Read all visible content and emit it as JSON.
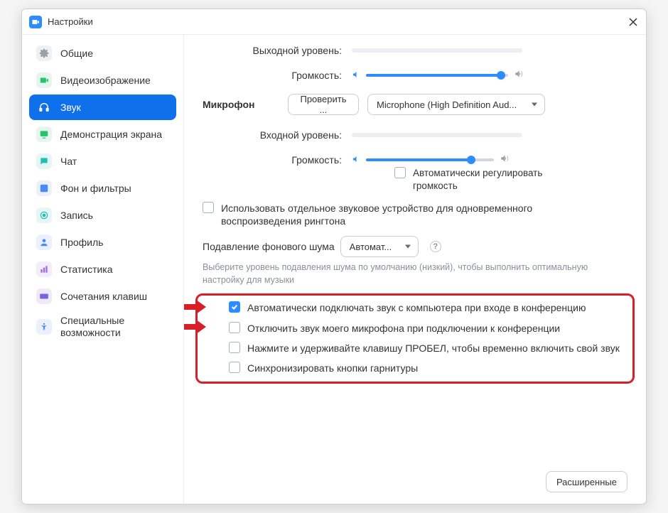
{
  "window": {
    "title": "Настройки"
  },
  "sidebar": {
    "items": [
      {
        "label": "Общие"
      },
      {
        "label": "Видеоизображение"
      },
      {
        "label": "Звук"
      },
      {
        "label": "Демонстрация экрана"
      },
      {
        "label": "Чат"
      },
      {
        "label": "Фон и фильтры"
      },
      {
        "label": "Запись"
      },
      {
        "label": "Профиль"
      },
      {
        "label": "Статистика"
      },
      {
        "label": "Сочетания клавиш"
      },
      {
        "label": "Специальные возможности"
      }
    ]
  },
  "content": {
    "output_level_label": "Выходной уровень:",
    "volume_label": "Громкость:",
    "microphone_heading": "Микрофон",
    "test_button": "Проверить ...",
    "mic_device": "Microphone (High Definition Aud...",
    "input_level_label": "Входной уровень:",
    "auto_adjust_volume": "Автоматически регулировать громкость",
    "separate_ringtone": "Использовать отдельное звуковое устройство для одновременного воспроизведения рингтона",
    "noise_suppress_label": "Подавление фонового шума",
    "noise_suppress_value": "Автомат...",
    "noise_hint": "Выберите уровень подавления шума по умолчанию (низкий), чтобы выполнить оптимальную настройку для музыки",
    "checkboxes": [
      {
        "label": "Автоматически подключать звук с компьютера при входе в конференцию",
        "checked": true
      },
      {
        "label": "Отключить звук моего микрофона при подключении к конференции",
        "checked": false
      },
      {
        "label": "Нажмите и удерживайте клавишу ПРОБЕЛ, чтобы временно включить свой звук",
        "checked": false
      },
      {
        "label": "Синхронизировать кнопки гарнитуры",
        "checked": false
      }
    ],
    "advanced_button": "Расширенные",
    "speaker_volume_percent": 95,
    "mic_volume_percent": 82
  },
  "colors": {
    "accent": "#2d8cff",
    "highlight": "#d81f27"
  }
}
